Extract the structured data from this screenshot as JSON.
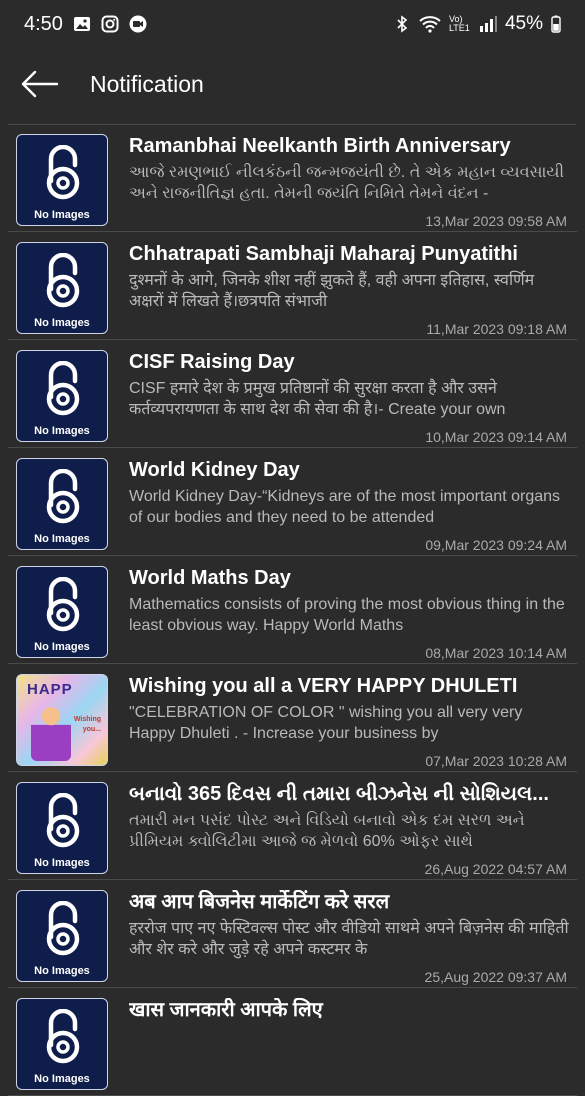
{
  "status": {
    "time": "4:50",
    "battery": "45%",
    "network": "Vo) LTE1"
  },
  "appbar": {
    "title": "Notification"
  },
  "thumbnail": {
    "no_images": "No Images",
    "photo_banner": "HAPP",
    "photo_text": "Wishing you..."
  },
  "notifications": [
    {
      "title": "Ramanbhai Neelkanth Birth Anniversary",
      "body": "આજે રમણભાઈ નીલકંઠની  જન્મજયંતી છે. તે એક મહાન વ્યવસાયી અને રાજનીતિજ્ઞ હતા. તેમની જયંતિ નિમિતે તેમને વંદન -",
      "date": "13,Mar 2023 09:58 AM",
      "thumb": "noimage"
    },
    {
      "title": "Chhatrapati Sambhaji Maharaj Punyatithi",
      "body": "दुश्मनों के आगे, जिनके शीश नहीं झुकते हैं, वही अपना इतिहास, स्वर्णिम अक्षरों में लिखते हैं।छत्रपति संभाजी",
      "date": "11,Mar 2023 09:18 AM",
      "thumb": "noimage"
    },
    {
      "title": "CISF Raising Day",
      "body": "CISF हमारे देश के प्रमुख प्रतिष्ठानों की सुरक्षा करता है और उसने कर्तव्यपरायणता के साथ देश की सेवा की है।- Create your own",
      "date": "10,Mar 2023 09:14 AM",
      "thumb": "noimage"
    },
    {
      "title": "World Kidney Day",
      "body": "World Kidney Day-“Kidneys are of the most important organs of our bodies and they need to be attended",
      "date": "09,Mar 2023 09:24 AM",
      "thumb": "noimage"
    },
    {
      "title": "World Maths Day",
      "body": "Mathematics consists of proving the most obvious thing in the least obvious way. Happy World Maths",
      "date": "08,Mar 2023 10:14 AM",
      "thumb": "noimage"
    },
    {
      "title": "Wishing you all a VERY HAPPY DHULETI",
      "body": "\"CELEBRATION OF COLOR \" wishing you all very very Happy Dhuleti . - Increase your business by",
      "date": "07,Mar 2023 10:28 AM",
      "thumb": "photo"
    },
    {
      "title": "બનાવો 365 દિવસ ની તમારા બીઝનેસ ની સોશિયલ...",
      "body": "તમારી મન પસંદ પોસ્ટ અને વિડિયો બનાવો એક દમ સરળ અને પ્રીમિયમ ક્વોલિટીમા આજે જ મેળવો 60% ઓફર સાથે",
      "date": "26,Aug 2022 04:57 AM",
      "thumb": "noimage"
    },
    {
      "title": "अब आप बिजनेस मार्केटिंग करे सरल",
      "body": "हररोज पाए नए फेस्टिवल्स पोस्ट और वीडियो साथमे अपने बिज़नेस की माहिती और शेर करे और जुड़े रहे अपने कस्टमर के",
      "date": "25,Aug 2022 09:37 AM",
      "thumb": "noimage"
    },
    {
      "title": "खास जानकारी आपके लिए",
      "body": "",
      "date": "",
      "thumb": "noimage"
    }
  ]
}
